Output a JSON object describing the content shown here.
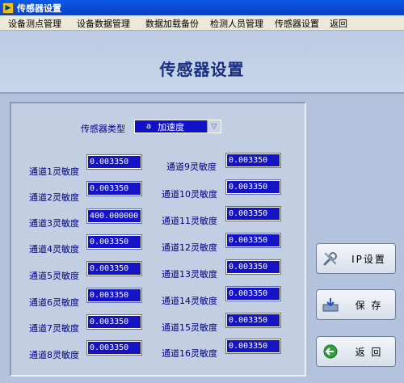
{
  "window": {
    "title": "传感器设置",
    "app_icon_glyph": "▶"
  },
  "menu": [
    {
      "label": "设备测点管理"
    },
    {
      "label": "设备数据管理"
    },
    {
      "label": "数据加载备份"
    },
    {
      "label": "检测人员管理"
    },
    {
      "label": "传感器设置"
    },
    {
      "label": "返回"
    }
  ],
  "page": {
    "title": "传感器设置"
  },
  "sensor_type": {
    "label": "传感器类型",
    "prefix": "a",
    "value": "加速度",
    "arrow": "▽"
  },
  "channels_left": [
    {
      "label": "通道1灵敏度",
      "value": "0.003350"
    },
    {
      "label": "通道2灵敏度",
      "value": "0.003350"
    },
    {
      "label": "通道3灵敏度",
      "value": "400.000000"
    },
    {
      "label": "通道4灵敏度",
      "value": "0.003350"
    },
    {
      "label": "通道5灵敏度",
      "value": "0.003350"
    },
    {
      "label": "通道6灵敏度",
      "value": "0.003350"
    },
    {
      "label": "通道7灵敏度",
      "value": "0.003350"
    },
    {
      "label": "通道8灵敏度",
      "value": "0.003350"
    }
  ],
  "channels_right": [
    {
      "label": "通道9灵敏度",
      "value": "0.003350"
    },
    {
      "label": "通道10灵敏度",
      "value": "0.003350"
    },
    {
      "label": "通道11灵敏度",
      "value": "0.003350"
    },
    {
      "label": "通道12灵敏度",
      "value": "0.003350"
    },
    {
      "label": "通道13灵敏度",
      "value": "0.003350"
    },
    {
      "label": "通道14灵敏度",
      "value": "0.003350"
    },
    {
      "label": "通道15灵敏度",
      "value": "0.003350"
    },
    {
      "label": "通道16灵敏度",
      "value": "0.003350"
    }
  ],
  "buttons": {
    "ip_settings": {
      "label": "IP设置",
      "icon": "tools-icon"
    },
    "save": {
      "label": "保 存",
      "icon": "save-tray-icon"
    },
    "back": {
      "label": "返 回",
      "icon": "back-arrow-icon"
    }
  },
  "colors": {
    "field_bg": "#1414c4",
    "title_color": "#1a2e80",
    "label_color": "#000080",
    "background": "#b3c3dd"
  }
}
